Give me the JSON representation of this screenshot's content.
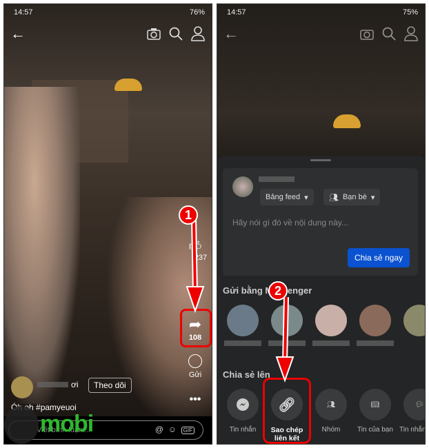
{
  "left": {
    "status": {
      "time": "14:57",
      "battery": "76%"
    },
    "actions": {
      "like_count": "237",
      "share_count": "108",
      "send_label": "Gửi"
    },
    "author": {
      "suffix": "ơi",
      "follow_label": "Theo dõi"
    },
    "caption": "Óh oh #pamyeuoi",
    "comment": {
      "placeholder": "Viết bình luận..."
    },
    "step": "1"
  },
  "right": {
    "status": {
      "time": "14:57",
      "battery": "75%"
    },
    "composer": {
      "audience_feed": "Bảng feed",
      "audience_friends": "Bạn bè",
      "placeholder": "Hãy nói gì đó về nội dung này...",
      "share_now": "Chia sẻ ngay"
    },
    "messenger_title": "Gửi bằng Messenger",
    "share_title": "Chia sẻ lên",
    "share_options": [
      {
        "label": "Tin nhắn",
        "icon": "messenger-icon"
      },
      {
        "label": "Sao chép liên kết",
        "icon": "link-icon"
      },
      {
        "label": "Nhóm",
        "icon": "group-icon"
      },
      {
        "label": "Tin của bạn",
        "icon": "book-icon"
      },
      {
        "label": "Tin nhắn bản",
        "icon": "chat-icon"
      }
    ],
    "step": "2"
  },
  "watermark": "mobi",
  "colors": {
    "accent_blue": "#0a52d0",
    "highlight_red": "#e00000",
    "watermark_green": "#2db82d"
  }
}
